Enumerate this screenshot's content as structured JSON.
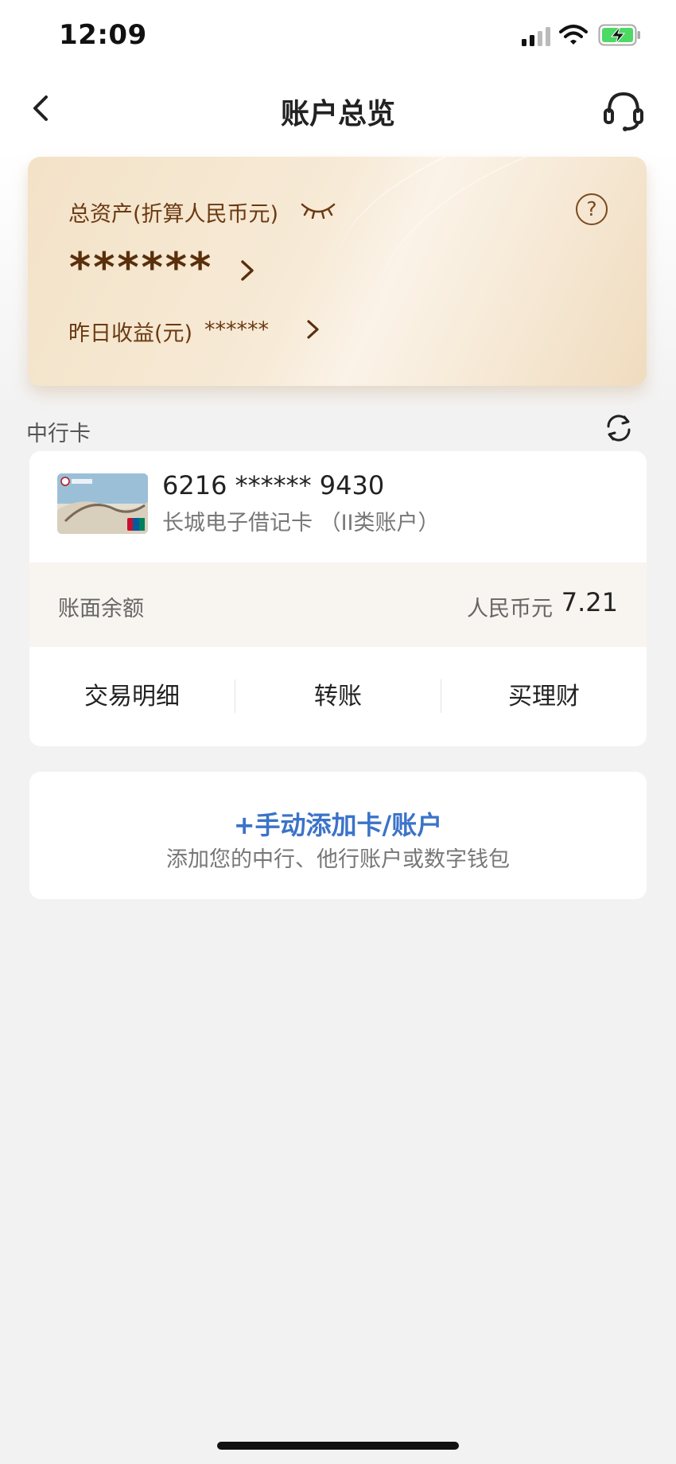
{
  "status_bar": {
    "time": "12:09",
    "icons": [
      "signal-icon",
      "wifi-icon",
      "battery-charging-icon"
    ],
    "battery_color": "#4cd964"
  },
  "nav": {
    "title": "账户总览",
    "back_icon": "chevron-left-icon",
    "service_icon": "headset-icon"
  },
  "asset_card": {
    "label": "总资产(折算人民币元)",
    "value": "******",
    "help_symbol": "?",
    "yesterday_label": "昨日收益(元)",
    "yesterday_value": "******",
    "text_color": "#6b3a12"
  },
  "section": {
    "title": "中行卡",
    "refresh_icon": "refresh-icon"
  },
  "bank_card": {
    "number": "6216 ****** 9430",
    "type": "长城电子借记卡 （II类账户）",
    "balance_label": "账面余额",
    "currency": "人民币元",
    "balance": "7.21",
    "actions": [
      "交易明细",
      "转账",
      "买理财"
    ]
  },
  "add_card": {
    "title": "+手动添加卡/账户",
    "subtitle": "添加您的中行、他行账户或数字钱包",
    "accent": "#3b73c9"
  }
}
